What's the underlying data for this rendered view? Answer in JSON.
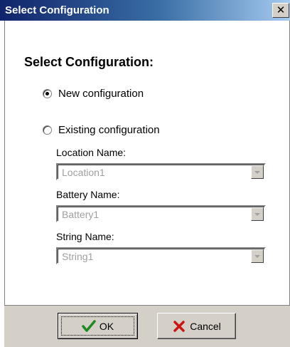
{
  "window": {
    "title": "Select Configuration",
    "close_glyph": "✕"
  },
  "content": {
    "heading": "Select Configuration:",
    "options": [
      {
        "label": "New configuration",
        "selected": true
      },
      {
        "label": "Existing configuration",
        "selected": false
      }
    ],
    "fields": [
      {
        "label": "Location Name:",
        "value": "Location1"
      },
      {
        "label": "Battery Name:",
        "value": "Battery1"
      },
      {
        "label": "String Name:",
        "value": "String1"
      }
    ]
  },
  "buttons": {
    "ok_label": "OK",
    "ok_icon": "green-checkmark-icon",
    "cancel_label": "Cancel",
    "cancel_icon": "red-x-icon"
  },
  "colors": {
    "titlebar_start": "#10246b",
    "titlebar_end": "#a6caf0",
    "disabled_text": "#a0a0a0",
    "button_face": "#d4d0c8"
  }
}
